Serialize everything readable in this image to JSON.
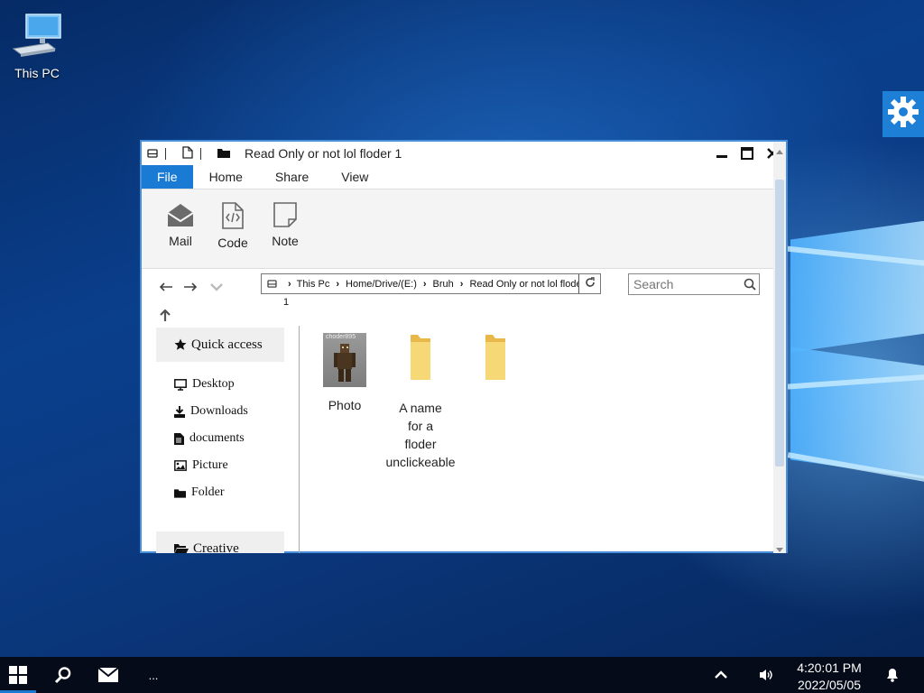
{
  "desktop": {
    "icon_label": "This PC"
  },
  "window": {
    "title": "Read Only or not lol floder 1",
    "minimize_glyph": "▬",
    "maximize_glyph": "▣",
    "close_glyph": "✕"
  },
  "menu": {
    "items": [
      "File",
      "Home",
      "Share",
      "View"
    ]
  },
  "ribbon": {
    "mail": "Mail",
    "code": "Code",
    "note": "Note"
  },
  "address": {
    "crumbs": [
      "This Pc",
      "Home/Drive/(E:)",
      "Bruh",
      "Read Only or not lol floder"
    ],
    "overflow": "1"
  },
  "search": {
    "placeholder": "Search"
  },
  "sidebar": {
    "quick_access": "Quick access",
    "items": [
      "Desktop",
      "Downloads",
      "documents",
      "Picture",
      "Folder"
    ],
    "creative": "Creative"
  },
  "files": [
    {
      "name": "Photo",
      "icon": "photo-thumbnail",
      "thumb_text": "choder895"
    },
    {
      "name": "A name for a floder unclickeable",
      "lines": [
        "A name",
        "for a",
        "floder",
        "unclickeable"
      ],
      "icon": "folder-icon"
    },
    {
      "name": "",
      "icon": "folder-icon"
    }
  ],
  "taskbar": {
    "more": "...",
    "time": "4:20:01 PM",
    "date": "2022/05/05"
  },
  "colors": {
    "accent": "#1a7bd4",
    "folder": "#f5d56a",
    "taskbar": "#050b18"
  }
}
